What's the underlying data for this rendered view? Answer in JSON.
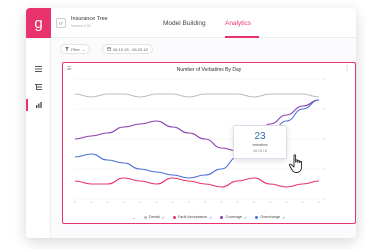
{
  "app": {
    "logo": "g"
  },
  "sidebar": {
    "items": [
      {
        "icon": "list-icon",
        "active": false
      },
      {
        "icon": "tree-icon",
        "active": false
      },
      {
        "icon": "bar-chart-icon",
        "active": true
      }
    ]
  },
  "topbar": {
    "avatar": "IT",
    "project_name": "Insurance Tree",
    "project_sub": "Version 1.02",
    "tabs": [
      {
        "label": "Model Building",
        "active": false
      },
      {
        "label": "Analytics",
        "active": true
      }
    ]
  },
  "filters": {
    "filter_label": "Filter",
    "date_range": "08.10.18 - 08.25.18"
  },
  "card": {
    "title": "Number of Verbatims By Day",
    "menu_icon": "hamburger-icon",
    "more_icon": "kebab-icon"
  },
  "tooltip": {
    "value": "23",
    "label": "verbatims",
    "date": "08.15.18"
  },
  "colors": {
    "accent": "#e8336c",
    "denial": "#bdbdbd",
    "fault": "#e8336c",
    "coverage": "#8a3fb3",
    "overcharge": "#4a6fd8"
  },
  "chart_data": {
    "type": "line",
    "title": "Number of Verbatims By Day",
    "x": [
      1,
      2,
      3,
      4,
      5,
      6,
      7,
      8,
      9,
      10,
      11,
      12,
      13,
      14,
      15,
      16
    ],
    "ylim": [
      0,
      40
    ],
    "grid": true,
    "legend_position": "bottom",
    "series": [
      {
        "name": "Denial",
        "values": [
          35,
          34,
          35,
          35,
          34,
          35,
          35,
          34,
          35,
          35,
          35,
          34,
          35,
          35,
          35,
          34
        ]
      },
      {
        "name": "Fault Acceptance",
        "values": [
          6,
          5,
          5,
          7,
          6,
          5,
          7,
          6,
          5,
          4,
          6,
          7,
          5,
          4,
          5,
          6
        ]
      },
      {
        "name": "Coverage",
        "values": [
          20,
          21,
          22,
          24,
          25,
          26,
          24,
          22,
          20,
          17,
          16,
          20,
          25,
          28,
          31,
          33
        ]
      },
      {
        "name": "Overcharge",
        "values": [
          14,
          15,
          13,
          12,
          10,
          9,
          8,
          7,
          8,
          10,
          14,
          18,
          22,
          26,
          30,
          33
        ]
      }
    ]
  },
  "legend": {
    "items": [
      {
        "name": "Denial",
        "color_key": "denial"
      },
      {
        "name": "Fault Acceptance",
        "color_key": "fault"
      },
      {
        "name": "Coverage",
        "color_key": "coverage"
      },
      {
        "name": "Overcharge",
        "color_key": "overcharge"
      }
    ]
  }
}
